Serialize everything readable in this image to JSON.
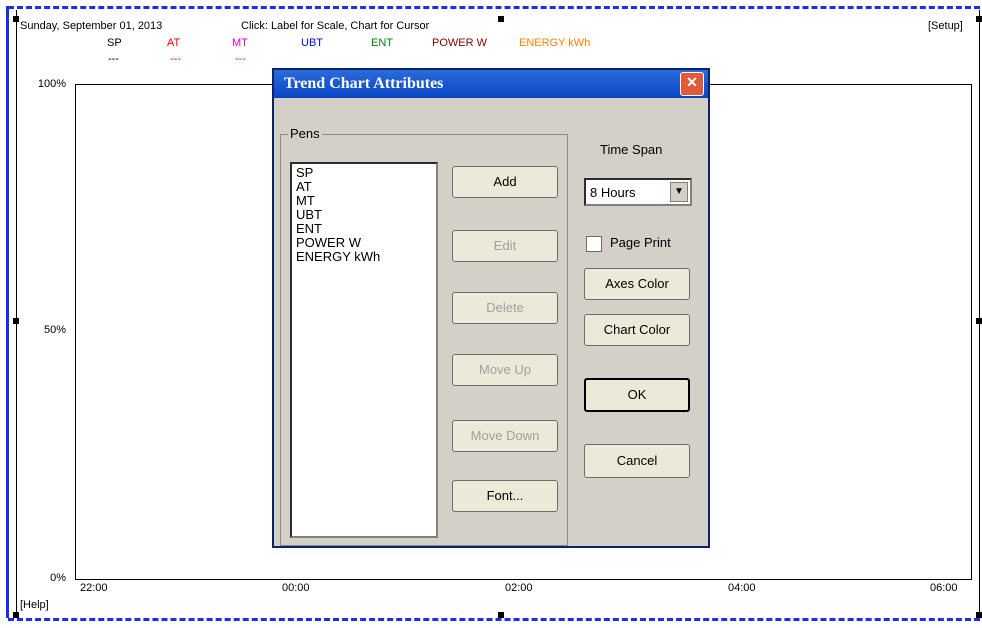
{
  "chart": {
    "date": "Sunday, September 01, 2013",
    "hint": "Click: Label for Scale, Chart for Cursor",
    "setup_label": "[Setup]",
    "help_label": "[Help]",
    "legend": [
      {
        "name": "SP",
        "value": "---",
        "color": "#000000"
      },
      {
        "name": "AT",
        "value": "---",
        "color": "#ff0000"
      },
      {
        "name": "MT",
        "value": "---",
        "color": "#e000c0"
      },
      {
        "name": "UBT",
        "value": "",
        "color": "#0000ff"
      },
      {
        "name": "ENT",
        "value": "",
        "color": "#008000"
      },
      {
        "name": "POWER W",
        "value": "",
        "color": "#800000"
      },
      {
        "name": "ENERGY kWh",
        "value": "",
        "color": "#ff8000"
      }
    ],
    "y_ticks": [
      "100%",
      "50%",
      "0%"
    ],
    "x_ticks": [
      "22:00",
      "00:00",
      "02:00",
      "04:00",
      "06:00"
    ]
  },
  "dialog": {
    "title": "Trend Chart Attributes",
    "close_icon": "close-icon",
    "pens_label": "Pens",
    "pens": [
      "SP",
      "AT",
      "MT",
      "UBT",
      "ENT",
      "POWER W",
      "ENERGY kWh"
    ],
    "buttons": {
      "add": "Add",
      "edit": "Edit",
      "delete": "Delete",
      "move_up": "Move Up",
      "move_down": "Move Down",
      "font": "Font...",
      "axes_color": "Axes Color",
      "chart_color": "Chart Color",
      "ok": "OK",
      "cancel": "Cancel"
    },
    "time_span_label": "Time Span",
    "time_span_value": "8 Hours",
    "page_print_label": "Page Print",
    "page_print_checked": false
  }
}
